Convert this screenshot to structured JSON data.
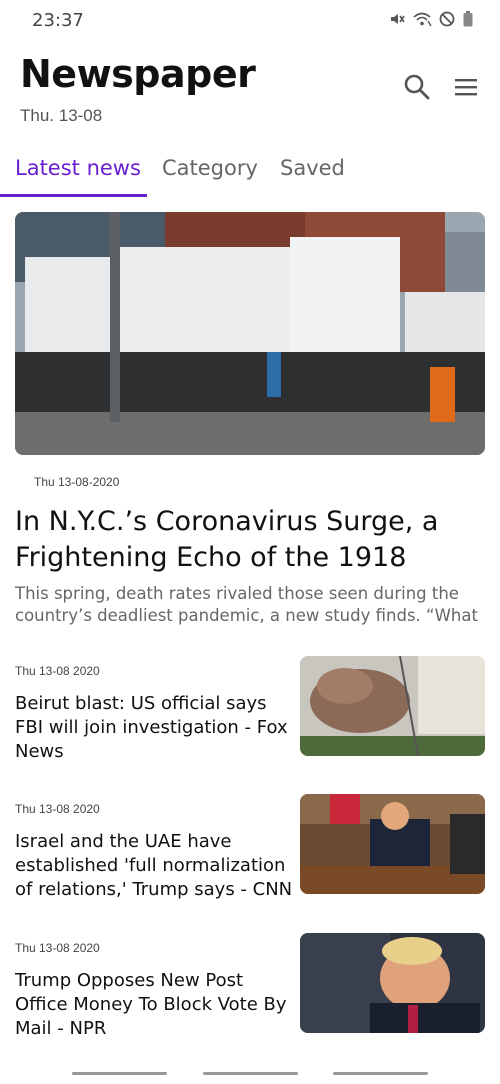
{
  "status_bar": {
    "time": "23:37"
  },
  "header": {
    "title": "Newspaper",
    "date": "Thu. 13-08"
  },
  "tabs": [
    {
      "label": "Latest news",
      "active": true
    },
    {
      "label": "Category",
      "active": false
    },
    {
      "label": "Saved",
      "active": false
    }
  ],
  "featured": {
    "date": "Thu 13-08-2020",
    "title": "In N.Y.C.’s Coronavirus Surge, a Frightening Echo of the 1918",
    "summary": "This spring, death rates rivaled those seen during the country’s deadliest pandemic, a new study finds. “What"
  },
  "articles": [
    {
      "date": "Thu 13-08 2020",
      "title": "Beirut blast: US official says FBI will join investigation - Fox News"
    },
    {
      "date": "Thu 13-08 2020",
      "title": "Israel and the UAE have established 'full normalization of relations,' Trump says - CNN"
    },
    {
      "date": "Thu 13-08 2020",
      "title": "Trump Opposes New Post Office Money To Block Vote By Mail - NPR"
    }
  ],
  "icons": {
    "search": "search-icon",
    "menu": "menu-icon",
    "mute": "mute-icon",
    "wifi": "wifi-icon",
    "dnd": "do-not-disturb-icon",
    "battery": "battery-icon"
  },
  "colors": {
    "accent": "#6a1fd0"
  }
}
